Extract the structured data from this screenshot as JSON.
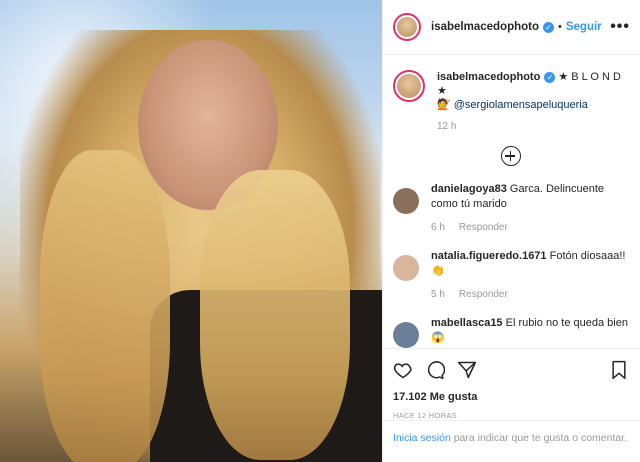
{
  "post": {
    "username": "isabelmacedophoto",
    "follow_label": "Seguir",
    "more_label": "•••",
    "separator": "•"
  },
  "caption": {
    "username": "isabelmacedophoto",
    "text": "★ B L O N D ★",
    "mention_emoji": "💇",
    "mention": "@sergiolamensapeluqueria",
    "time": "12 h"
  },
  "comments": [
    {
      "username": "danielagoya83",
      "text": "Garca. Delincuente como tú marido",
      "time": "6 h",
      "reply_label": "Responder",
      "avatar_color": "#8a6f5a"
    },
    {
      "username": "natalia.figueredo.1671",
      "text": "Fotón diosaaa!! 👏",
      "time": "5 h",
      "reply_label": "Responder",
      "avatar_color": "#d9b59b"
    },
    {
      "username": "mabellasca15",
      "text": "El rubio no te queda bien 😱",
      "time": "",
      "reply_label": "",
      "avatar_color": "#6b7f99"
    }
  ],
  "stats": {
    "likes": "17.102 Me gusta",
    "posted": "HACE 12 HORAS"
  },
  "login": {
    "link": "Inicia sesión",
    "text": " para indicar que te gusta o comentar."
  },
  "colors": {
    "accent": "#3897f0",
    "ring": "#e1306c"
  }
}
